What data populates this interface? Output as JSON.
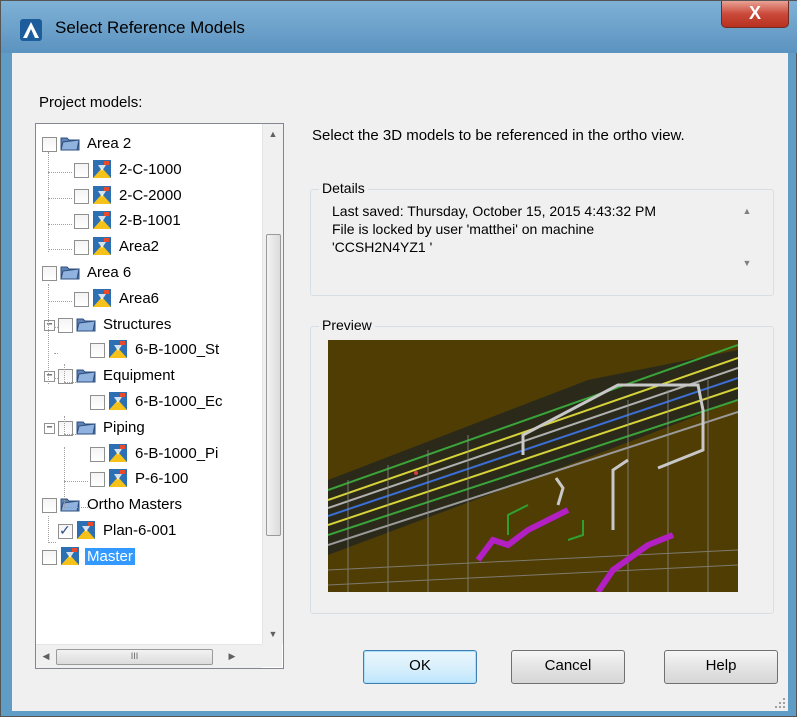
{
  "window": {
    "title": "Select Reference Models",
    "close_glyph": "X",
    "app_icon": "autocad-plant-icon"
  },
  "project_models_label": "Project models:",
  "instruction": "Select the 3D models to be referenced in the ortho view.",
  "tree": {
    "items": [
      {
        "label": "Area 2",
        "icon": "folder-icon",
        "checked": false
      },
      {
        "label": "2-C-1000",
        "icon": "model-icon",
        "checked": false
      },
      {
        "label": "2-C-2000",
        "icon": "model-icon",
        "checked": false
      },
      {
        "label": "2-B-1001",
        "icon": "model-icon",
        "checked": false
      },
      {
        "label": "Area2",
        "icon": "model-icon",
        "checked": false
      },
      {
        "label": "Area 6",
        "icon": "folder-icon",
        "checked": false
      },
      {
        "label": "Area6",
        "icon": "model-icon",
        "checked": false
      },
      {
        "label": "Structures",
        "icon": "folder-icon",
        "checked": false
      },
      {
        "label": "6-B-1000_St",
        "icon": "model-icon",
        "checked": false
      },
      {
        "label": "Equipment",
        "icon": "folder-icon",
        "checked": false
      },
      {
        "label": "6-B-1000_Ec",
        "icon": "model-icon",
        "checked": false
      },
      {
        "label": "Piping",
        "icon": "folder-icon",
        "checked": false
      },
      {
        "label": "6-B-1000_Pi",
        "icon": "model-icon",
        "checked": false
      },
      {
        "label": "P-6-100",
        "icon": "model-icon",
        "checked": false
      },
      {
        "label": "Ortho Masters",
        "icon": "folder-icon",
        "checked": false
      },
      {
        "label": "Plan-6-001",
        "icon": "model-icon",
        "checked": true
      },
      {
        "label": "Master",
        "icon": "model-icon",
        "checked": false,
        "selected": true
      }
    ],
    "hscroll_thumb_glyph": "III"
  },
  "details": {
    "title": "Details",
    "line1": "Last saved: Thursday, October 15, 2015 4:43:32 PM",
    "line2": "File is locked by user 'matthei' on machine",
    "line3": "'CCSH2N4YZ1 '"
  },
  "preview": {
    "title": "Preview"
  },
  "buttons": {
    "ok": "OK",
    "cancel": "Cancel",
    "help": "Help"
  },
  "colors": {
    "titlebar": "#6aa3cd",
    "close": "#c9493a",
    "selection": "#3399ff",
    "preview_bg": "#4f3d04"
  }
}
